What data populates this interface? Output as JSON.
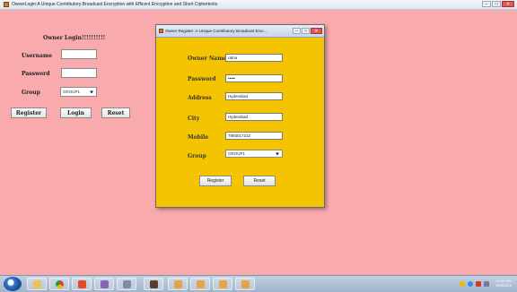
{
  "main_window": {
    "title": "OwnerLogin:A Unique Contributory Broadcast Encryption with Efficent Encryption and Short Ciphertexts"
  },
  "login": {
    "title": "Owner Login!!!!!!!!!!",
    "username_label": "Username",
    "username_value": "",
    "password_label": "Password",
    "password_value": "",
    "group_label": "Group",
    "group_value": "GROUP1",
    "register_label": "Register",
    "login_label": "Login",
    "reset_label": "Reset"
  },
  "register_dialog": {
    "title": "Owner Register :A Unique Contributory Broadcast Encr...",
    "fields": [
      {
        "label": "Owner Name",
        "value": "ratna"
      },
      {
        "label": "Password",
        "value": "•••••"
      },
      {
        "label": "Address",
        "value": "Hyderabad"
      },
      {
        "label": "City",
        "value": "Hyderabad"
      },
      {
        "label": "Mobile",
        "value": "7893017212"
      }
    ],
    "group_label": "Group",
    "group_value": "GROUP1",
    "register_label": "Register",
    "reset_label": "Reset"
  },
  "taskbar": {
    "time": "12:38 PM",
    "date": "3/29/2016"
  },
  "colors": {
    "background": "#f9aaad",
    "dialog_background": "#f5c400"
  }
}
